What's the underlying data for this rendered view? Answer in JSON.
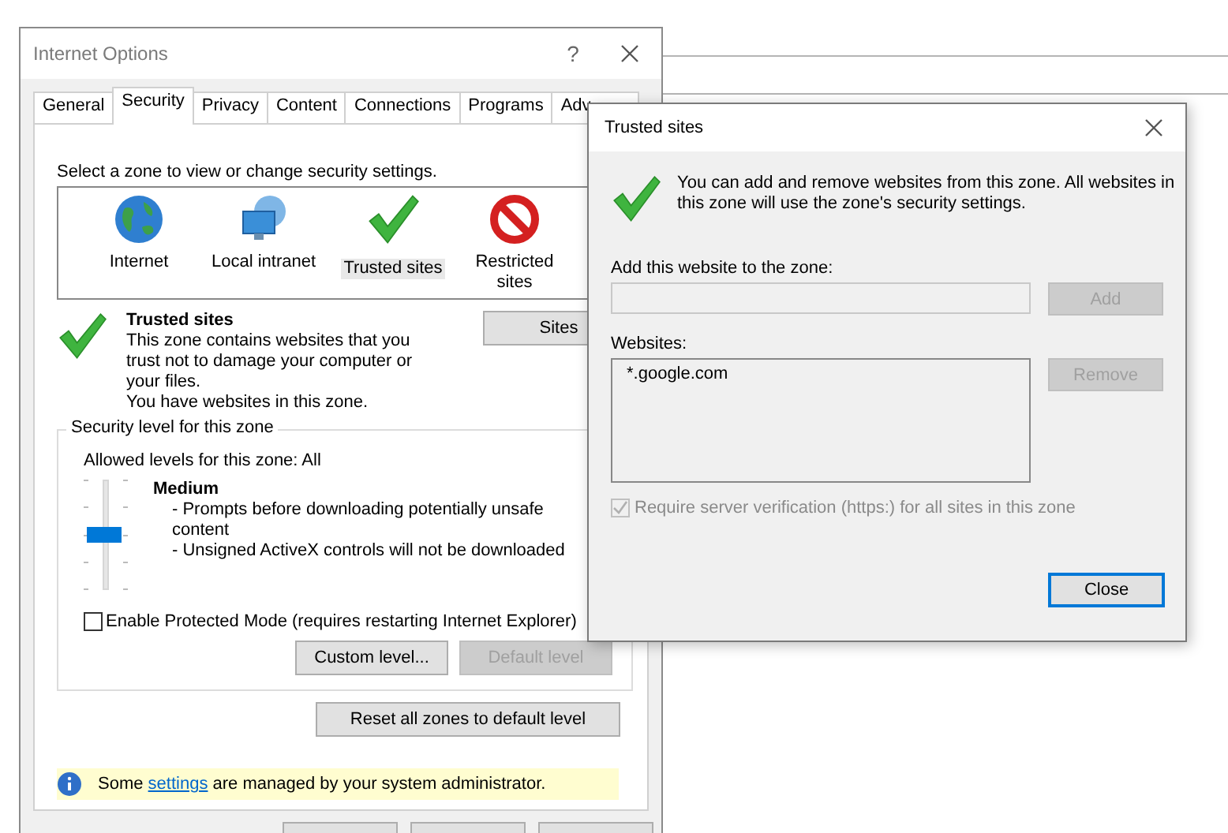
{
  "internet_options": {
    "title": "Internet Options",
    "help_button": "?",
    "tabs": [
      {
        "label": "General",
        "selected": false
      },
      {
        "label": "Security",
        "selected": true
      },
      {
        "label": "Privacy",
        "selected": false
      },
      {
        "label": "Content",
        "selected": false
      },
      {
        "label": "Connections",
        "selected": false
      },
      {
        "label": "Programs",
        "selected": false
      },
      {
        "label": "Adv",
        "selected": false
      }
    ],
    "zone_prompt": "Select a zone to view or change security settings.",
    "zones": [
      {
        "kind": "internet",
        "label": "Internet",
        "selected": false
      },
      {
        "kind": "intranet",
        "label": "Local intranet",
        "selected": false
      },
      {
        "kind": "trusted",
        "label": "Trusted sites",
        "selected": true
      },
      {
        "kind": "restricted",
        "label": "Restricted sites",
        "selected": false
      }
    ],
    "zone_title": "Trusted sites",
    "zone_description": "This zone contains websites that you trust not to damage your computer or your files.",
    "zone_status": "You have websites in this zone.",
    "sites_button": "Sites",
    "security_level": {
      "group_label": "Security level for this zone",
      "allowed_levels": "Allowed levels for this zone: All",
      "level": 0.5,
      "level_name": "Medium",
      "details": [
        "- Prompts before downloading potentially unsafe content",
        "- Unsigned ActiveX controls will not be downloaded"
      ]
    },
    "protected_mode": {
      "label": "Enable Protected Mode (requires restarting Internet Explorer)",
      "checked": false
    },
    "custom_level_button": {
      "label": "Custom level...",
      "disabled": false
    },
    "default_level_button": {
      "label": "Default level",
      "disabled": true
    },
    "reset_button": "Reset all zones to default level",
    "info_bar": {
      "text_before": "Some ",
      "link": "settings",
      "text_after": " are managed by your system administrator."
    }
  },
  "trusted_sites_dialog": {
    "title": "Trusted sites",
    "description": "You can add and remove websites from this zone. All websites in this zone will use the zone's security settings.",
    "add_label": "Add this website to the zone:",
    "add_button": {
      "label": "Add",
      "disabled": true
    },
    "websites_label": "Websites:",
    "websites": [
      {
        "label": "*.google.com",
        "selected": false
      }
    ],
    "remove_button": {
      "label": "Remove",
      "disabled": true
    },
    "https_check": {
      "label": "Require server verification (https:) for all sites in this zone",
      "checked": true,
      "disabled": true
    },
    "close_button": {
      "label": "Close",
      "focused": true
    }
  }
}
